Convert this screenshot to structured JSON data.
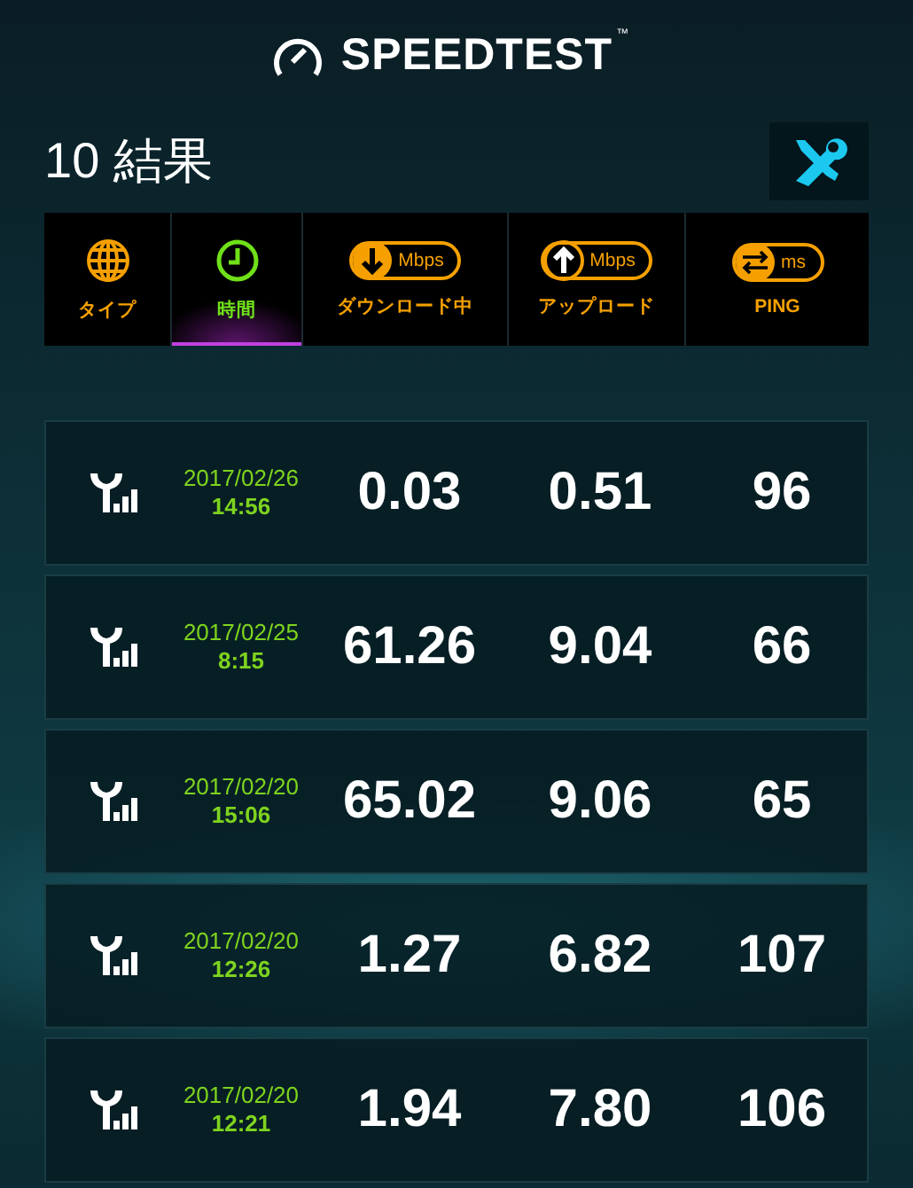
{
  "logo": {
    "text": "SPEEDTEST",
    "trademark": "™"
  },
  "title": "10 結果",
  "tabs": [
    {
      "kind": "globe",
      "label": "タイプ",
      "selected": false
    },
    {
      "kind": "clock",
      "label": "時間",
      "selected": true
    },
    {
      "kind": "download",
      "unit": "Mbps",
      "label": "ダウンロード中",
      "selected": false
    },
    {
      "kind": "upload",
      "unit": "Mbps",
      "label": "アップロード",
      "selected": false
    },
    {
      "kind": "ping",
      "unit": "ms",
      "label": "PING",
      "selected": false
    }
  ],
  "results": [
    {
      "date": "2017/02/26",
      "time": "14:56",
      "download": "0.03",
      "upload": "0.51",
      "ping": "96"
    },
    {
      "date": "2017/02/25",
      "time": "8:15",
      "download": "61.26",
      "upload": "9.04",
      "ping": "66"
    },
    {
      "date": "2017/02/20",
      "time": "15:06",
      "download": "65.02",
      "upload": "9.06",
      "ping": "65"
    },
    {
      "date": "2017/02/20",
      "time": "12:26",
      "download": "1.27",
      "upload": "6.82",
      "ping": "107"
    },
    {
      "date": "2017/02/20",
      "time": "12:21",
      "download": "1.94",
      "upload": "7.80",
      "ping": "106"
    }
  ]
}
